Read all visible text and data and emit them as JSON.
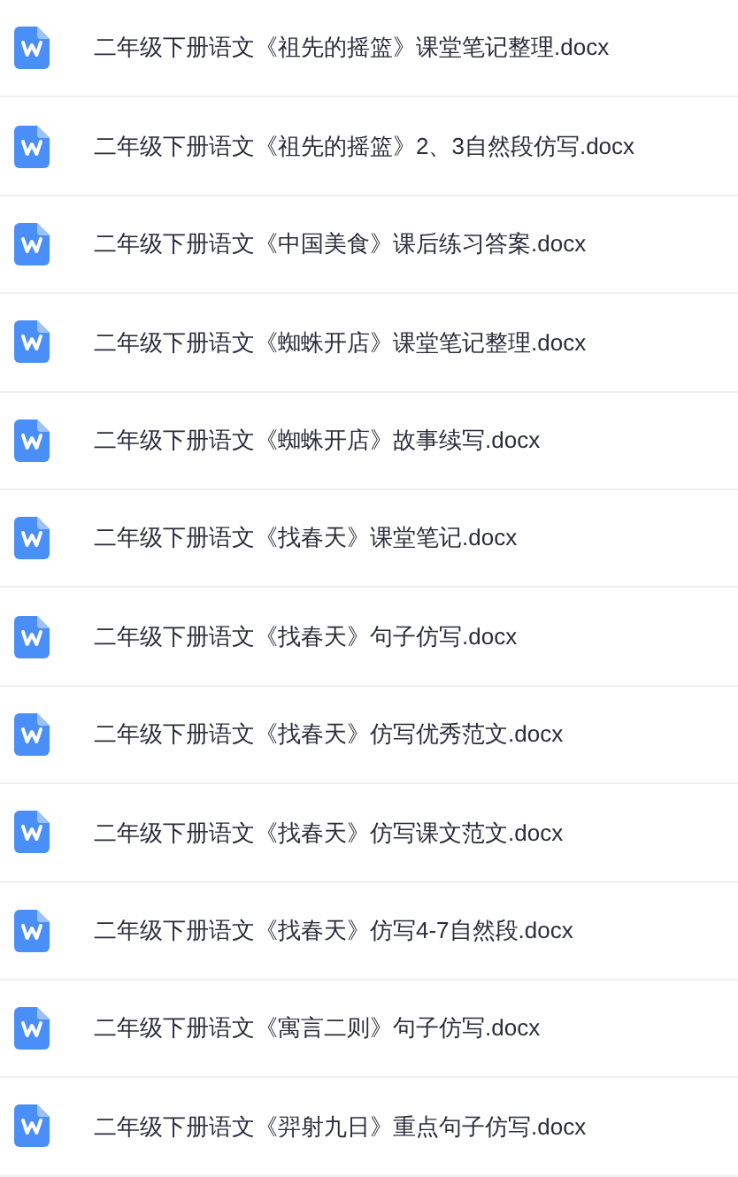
{
  "files": [
    {
      "name": "二年级下册语文《祖先的摇篮》课堂笔记整理.docx"
    },
    {
      "name": "二年级下册语文《祖先的摇篮》2、3自然段仿写.docx"
    },
    {
      "name": "二年级下册语文《中国美食》课后练习答案.docx"
    },
    {
      "name": "二年级下册语文《蜘蛛开店》课堂笔记整理.docx"
    },
    {
      "name": "二年级下册语文《蜘蛛开店》故事续写.docx"
    },
    {
      "name": "二年级下册语文《找春天》课堂笔记.docx"
    },
    {
      "name": "二年级下册语文《找春天》句子仿写.docx"
    },
    {
      "name": "二年级下册语文《找春天》仿写优秀范文.docx"
    },
    {
      "name": "二年级下册语文《找春天》仿写课文范文.docx"
    },
    {
      "name": "二年级下册语文《找春天》仿写4-7自然段.docx"
    },
    {
      "name": "二年级下册语文《寓言二则》句子仿写.docx"
    },
    {
      "name": "二年级下册语文《羿射九日》重点句子仿写.docx"
    }
  ]
}
